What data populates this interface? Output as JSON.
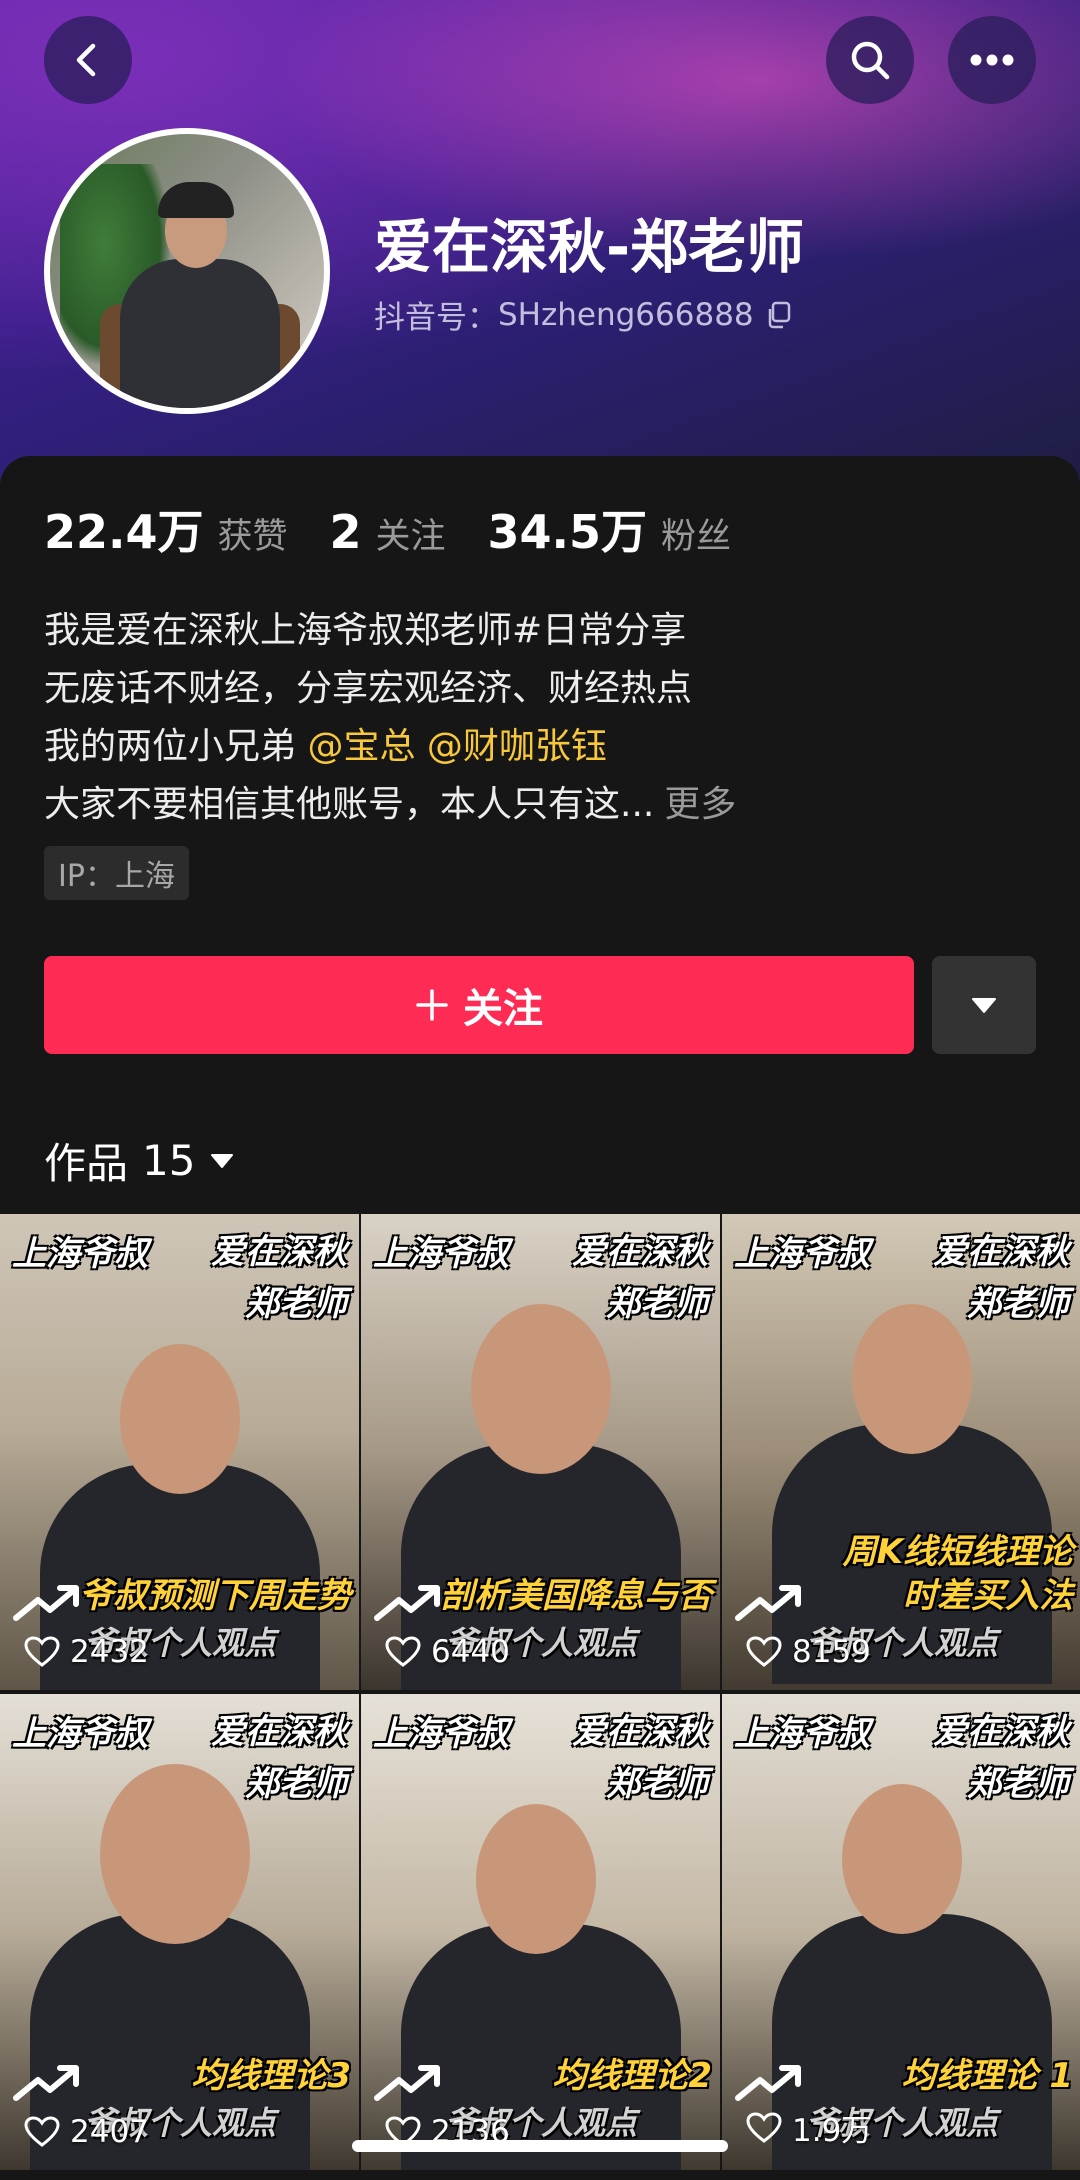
{
  "profile": {
    "name": "爱在深秋-郑老师",
    "uid_label": "抖音号：",
    "uid_value": "SHzheng666888"
  },
  "stats": {
    "likes_num": "22.4万",
    "likes_label": "获赞",
    "following_num": "2",
    "following_label": "关注",
    "followers_num": "34.5万",
    "followers_label": "粉丝"
  },
  "bio": {
    "line1": "我是爱在深秋上海爷叔郑老师#日常分享",
    "line2": "无废话不财经，分享宏观经济、财经热点",
    "line3_prefix": "我的两位小兄弟 ",
    "mention1": "@宝总",
    "mention2": "@财咖张钰",
    "line4": "大家不要相信其他账号，本人只有这...",
    "more": "更多"
  },
  "ip": "IP：上海",
  "follow_button": "关注",
  "works": {
    "label": "作品",
    "count": "15"
  },
  "videos": [
    {
      "cap_left": "上海爷叔",
      "cap_right1": "爱在深秋",
      "cap_right2": "郑老师",
      "headline1": "爷叔预测下周走势",
      "headline2": "",
      "sub": "爷叔个人观点",
      "likes": "2432"
    },
    {
      "cap_left": "上海爷叔",
      "cap_right1": "爱在深秋",
      "cap_right2": "郑老师",
      "headline1": "剖析美国降息与否",
      "headline2": "",
      "sub": "爷叔个人观点",
      "likes": "6440"
    },
    {
      "cap_left": "上海爷叔",
      "cap_right1": "爱在深秋",
      "cap_right2": "郑老师",
      "headline1": "周K线短线理论",
      "headline2": "时差买入法",
      "sub": "爷叔个人观点",
      "likes": "8159"
    },
    {
      "cap_left": "上海爷叔",
      "cap_right1": "爱在深秋",
      "cap_right2": "郑老师",
      "headline1": "均线理论3",
      "headline2": "",
      "sub": "爷叔个人观点",
      "likes": "2407"
    },
    {
      "cap_left": "上海爷叔",
      "cap_right1": "爱在深秋",
      "cap_right2": "郑老师",
      "headline1": "均线理论2",
      "headline2": "",
      "sub": "爷叔个人观点",
      "likes": "2136"
    },
    {
      "cap_left": "上海爷叔",
      "cap_right1": "爱在深秋",
      "cap_right2": "郑老师",
      "headline1": "均线理论 1",
      "headline2": "",
      "sub": "爷叔个人观点",
      "likes": "1.9万"
    }
  ],
  "icons": {
    "back": "back-icon",
    "search": "search-icon",
    "more": "more-icon",
    "copy": "copy-icon",
    "plus": "plus-icon",
    "dropdown": "caret-down-icon",
    "heart": "heart-icon"
  },
  "colors": {
    "accent": "#fe2c55",
    "mention": "#f7c73c",
    "headline": "#ffd23a"
  }
}
